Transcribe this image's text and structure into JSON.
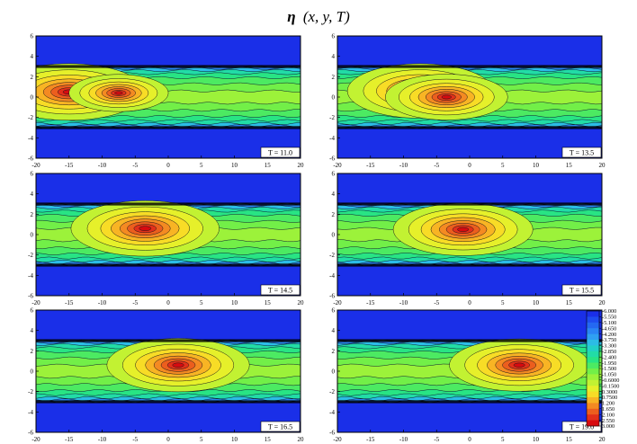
{
  "title": {
    "symbol": "η",
    "args": "(x, y, T)"
  },
  "colors": {
    "background_fill": "#1a2fe8",
    "scale": [
      "#1a2fe8",
      "#1e4cf0",
      "#2468f2",
      "#2a84f4",
      "#2fa0f2",
      "#2cbce6",
      "#22d0c8",
      "#22dca6",
      "#28e484",
      "#4cea62",
      "#72ef48",
      "#9cf23a",
      "#c2f232",
      "#e6f02a",
      "#f8dc26",
      "#f8b424",
      "#f48a22",
      "#ec5e1e",
      "#e2301a",
      "#d80a10"
    ]
  },
  "chart_data": {
    "type": "contour",
    "grid": false,
    "legend_position": "right of bottom-right panel",
    "x_ticks": [
      -20,
      -15,
      -10,
      -5,
      0,
      5,
      10,
      15,
      20
    ],
    "y_ticks": [
      -6,
      -4,
      -2,
      0,
      2,
      4,
      6
    ],
    "xlim": [
      -20,
      20
    ],
    "ylim": [
      -6,
      6
    ],
    "channel_edges_y": [
      -3,
      3
    ],
    "levels": [
      "-6.000",
      "-5.550",
      "-5.100",
      "-4.650",
      "-4.200",
      "-3.750",
      "-3.300",
      "-2.850",
      "-2.400",
      "-1.950",
      "-1.500",
      "-1.050",
      "-0.6000",
      "-0.1500",
      "0.3000",
      "0.7500",
      "1.200",
      "1.650",
      "2.100",
      "2.550",
      "3.000"
    ],
    "panels": [
      {
        "T_label": "T = 11.0",
        "peaks": [
          {
            "x": -15,
            "y": 0.5,
            "amplitude": 3.0
          },
          {
            "x": -7.5,
            "y": 0.4,
            "amplitude": 1.2
          }
        ]
      },
      {
        "T_label": "T = 13.5",
        "peaks": [
          {
            "x": -7.5,
            "y": 0.6,
            "amplitude": 2.8
          },
          {
            "x": -3.5,
            "y": 0.0,
            "amplitude": 2.0
          }
        ]
      },
      {
        "T_label": "T = 14.5",
        "peaks": [
          {
            "x": -3.5,
            "y": 0.6,
            "amplitude": 2.9
          }
        ]
      },
      {
        "T_label": "T = 15.5",
        "peaks": [
          {
            "x": -1.0,
            "y": 0.5,
            "amplitude": 2.6
          }
        ]
      },
      {
        "T_label": "T = 16.5",
        "peaks": [
          {
            "x": 1.5,
            "y": 0.6,
            "amplitude": 2.7
          }
        ]
      },
      {
        "T_label": "T = 19.0",
        "peaks": [
          {
            "x": 7.5,
            "y": 0.6,
            "amplitude": 2.6
          }
        ]
      }
    ]
  }
}
